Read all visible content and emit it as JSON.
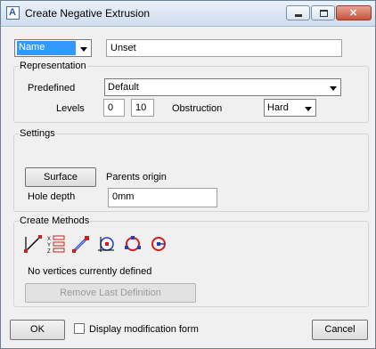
{
  "window": {
    "title": "Create Negative Extrusion"
  },
  "name_row": {
    "selector_value": "Name",
    "name_value": "Unset"
  },
  "representation": {
    "group_label": "Representation",
    "predefined_label": "Predefined",
    "predefined_value": "Default",
    "levels_label": "Levels",
    "level_min": "0",
    "level_max": "10",
    "obstruction_label": "Obstruction",
    "obstruction_value": "Hard"
  },
  "settings": {
    "group_label": "Settings",
    "surface_button": "Surface",
    "parents_origin": "Parents origin",
    "hole_depth_label": "Hole depth",
    "hole_depth_value": "0mm"
  },
  "create_methods": {
    "group_label": "Create Methods",
    "status": "No vertices currently defined",
    "remove_button": "Remove Last Definition",
    "icons": [
      "line-icon",
      "xyz-coordinates-icon",
      "pick-point-icon",
      "circle-tangent-icon",
      "circle-three-point-icon",
      "circle-center-icon"
    ]
  },
  "footer": {
    "ok_button": "OK",
    "display_form_label": "Display modification form",
    "display_form_checked": false,
    "cancel_button": "Cancel"
  },
  "colors": {
    "selection_blue": "#3399ff",
    "icon_red": "#cc1f1f",
    "icon_blue": "#2440b5"
  }
}
